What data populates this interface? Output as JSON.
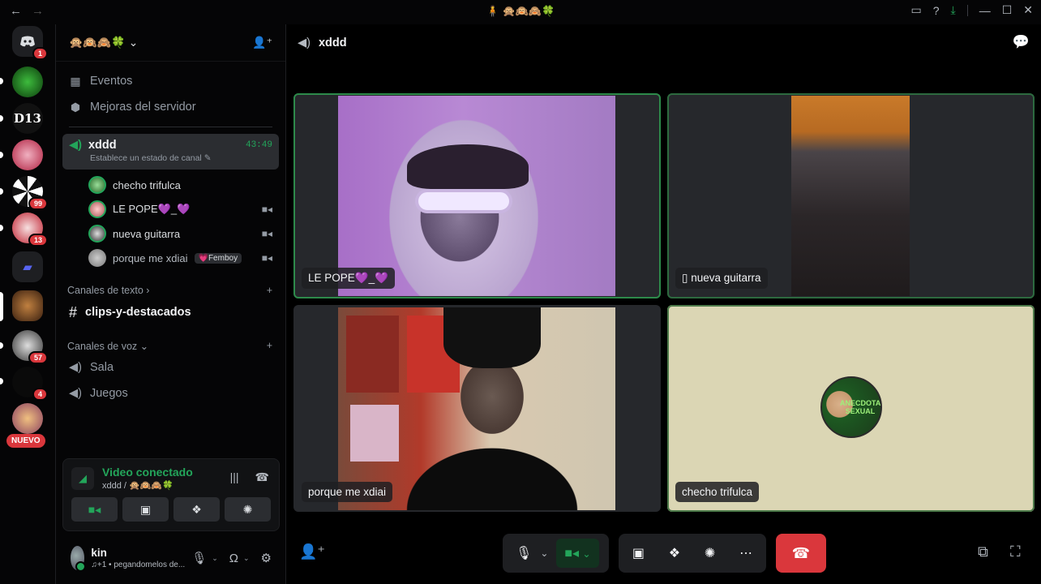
{
  "titlebar": {
    "back": "←",
    "forward": "→",
    "server_name": "🧍 🙊🙉🙈🍀"
  },
  "rail": {
    "badges": [
      "1",
      "99",
      "13",
      "57",
      "4"
    ],
    "d13_label": "D13",
    "nuevo": "NUEVO"
  },
  "sidebar": {
    "server_header": "🙊🙉🙈🍀",
    "events": "Eventos",
    "boosts": "Mejoras del servidor",
    "active_channel": {
      "name": "xddd",
      "timer": "43:49",
      "status": "Establece un estado de canal"
    },
    "users": [
      {
        "name": "checho trifulca",
        "tag": ""
      },
      {
        "name": "LE POPE💜_💜",
        "tag": ""
      },
      {
        "name": "nueva guitarra",
        "tag": ""
      },
      {
        "name": "porque me xdiai",
        "tag": "💗Femboy"
      }
    ],
    "text_category": "Canales de texto",
    "text_channel": "clips-y-destacados",
    "voice_category": "Canales de voz",
    "voice_channels": [
      "Sala",
      "Juegos"
    ]
  },
  "voice_panel": {
    "title": "Video conectado",
    "subtitle": "xddd / 🙊🙉🙈🍀"
  },
  "user": {
    "name": "kin",
    "status": "♫+1 • pegandomelos de..."
  },
  "main": {
    "channel": "xddd",
    "tiles": [
      {
        "label": "LE POPE💜_💜"
      },
      {
        "label": "nueva guitarra"
      },
      {
        "label": "porque me xdiai"
      },
      {
        "label": "checho trifulca"
      }
    ],
    "avatar_text": "ANECDOTA SEXUAL"
  },
  "colors": {
    "accent_green": "#23a55a",
    "danger": "#da373c",
    "speaking_border": "#2d8a4a"
  }
}
